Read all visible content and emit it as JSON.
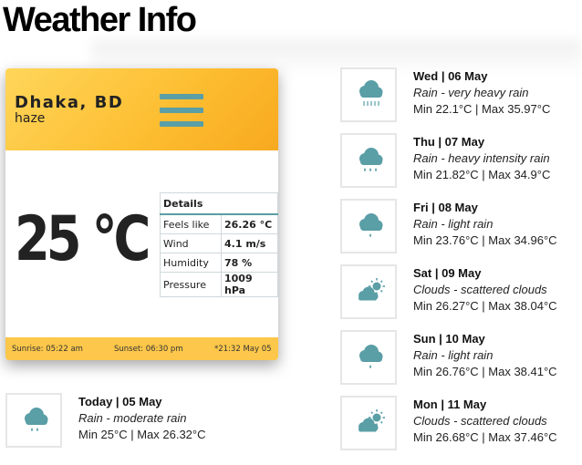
{
  "page": {
    "title": "Weather Info"
  },
  "current": {
    "city": "Dhaka, BD",
    "condition": "haze",
    "temperature": "25 °C",
    "details_header": "Details",
    "details": [
      {
        "label": "Feels like",
        "value": "26.26 °C"
      },
      {
        "label": "Wind",
        "value": "4.1 m/s"
      },
      {
        "label": "Humidity",
        "value": "78 %"
      },
      {
        "label": "Pressure",
        "value": "1009 hPa"
      }
    ],
    "sunrise": "Sunrise: 05:22 am",
    "sunset": "Sunset: 06:30 pm",
    "updated": "*21:32 May 05",
    "menu_icon": "hamburger-menu-icon"
  },
  "today": {
    "title": "Today | 05 May",
    "desc": "Rain - moderate rain",
    "range": "Min 25°C | Max 26.32°C",
    "icon": "rain-cloud-icon"
  },
  "forecast": [
    {
      "title": "Wed | 06 May",
      "desc": "Rain - very heavy rain",
      "range": "Min 22.1°C | Max 35.97°C",
      "icon": "heavy-rain-cloud-icon"
    },
    {
      "title": "Thu | 07 May",
      "desc": "Rain - heavy intensity rain",
      "range": "Min 21.82°C | Max 34.9°C",
      "icon": "rain-cloud-icon"
    },
    {
      "title": "Fri | 08 May",
      "desc": "Rain - light rain",
      "range": "Min 23.76°C | Max 34.96°C",
      "icon": "light-rain-cloud-icon"
    },
    {
      "title": "Sat | 09 May",
      "desc": "Clouds - scattered clouds",
      "range": "Min 26.27°C | Max 38.04°C",
      "icon": "sun-cloud-icon"
    },
    {
      "title": "Sun | 10 May",
      "desc": "Rain - light rain",
      "range": "Min 26.76°C | Max 38.41°C",
      "icon": "light-rain-cloud-icon"
    },
    {
      "title": "Mon | 11 May",
      "desc": "Clouds - scattered clouds",
      "range": "Min 26.68°C | Max 37.46°C",
      "icon": "sun-cloud-icon"
    }
  ],
  "colors": {
    "accent": "#5a9ea6",
    "header_yellow": "#fdbf33",
    "footer_yellow": "#fcc74a"
  }
}
